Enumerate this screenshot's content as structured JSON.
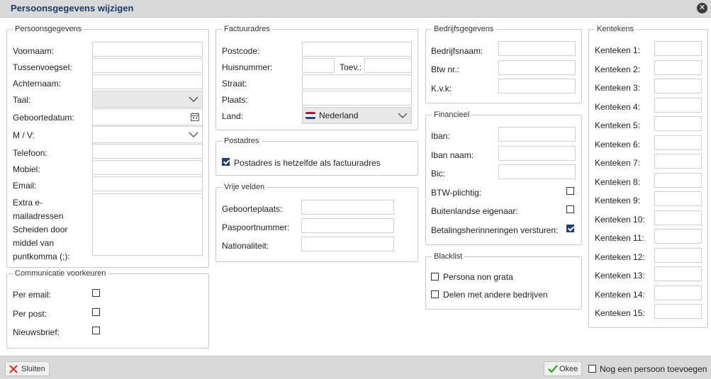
{
  "window": {
    "title": "Persoonsgegevens wijzigen"
  },
  "persoonsgegevens": {
    "legend": "Persoonsgegevens",
    "voornaam": "Voornaam:",
    "tussenvoegsel": "Tussenvoegsel:",
    "achternaam": "Achternaam:",
    "taal": "Taal:",
    "geboortedatum": "Geboortedatum:",
    "mv": "M / V:",
    "telefoon": "Telefoon:",
    "mobiel": "Mobiel:",
    "email": "Email:",
    "extra_lines": [
      "Extra e-",
      "mailadressen",
      "Scheiden door",
      "middel van",
      "puntkomma (;):"
    ]
  },
  "communicatie": {
    "legend": "Communicatie voorkeuren",
    "per_email": "Per email:",
    "per_post": "Per post:",
    "nieuwsbrief": "Nieuwsbrief:"
  },
  "factuuradres": {
    "legend": "Factuuradres",
    "postcode": "Postcode:",
    "huisnummer": "Huisnummer:",
    "toev": "Toev.:",
    "straat": "Straat:",
    "plaats": "Plaats:",
    "land": "Land:",
    "land_value": "Nederland"
  },
  "postadres": {
    "legend": "Postadres",
    "same_label": "Postadres is hetzelfde als factuuradres",
    "same_checked": true
  },
  "vrije_velden": {
    "legend": "Vrije velden",
    "geboorteplaats": "Geboorteplaats:",
    "paspoortnummer": "Paspoortnummer:",
    "nationaliteit": "Nationaliteit:"
  },
  "bedrijfsgegevens": {
    "legend": "Bedrijfsgegevens",
    "bedrijfsnaam": "Bedrijfsnaam:",
    "btw_nr": "Btw nr.:",
    "kvk": "K.v.k:"
  },
  "financieel": {
    "legend": "Financieel",
    "iban": "Iban:",
    "iban_naam": "Iban naam:",
    "bic": "Bic:",
    "btw_plichtig": "BTW-plichtig:",
    "buitenlandse": "Buitenlandse eigenaar:",
    "herinneringen": "Betalingsherinneringen versturen:",
    "herinneringen_checked": true
  },
  "blacklist": {
    "legend": "Blacklist",
    "non_grata": "Persona non grata",
    "delen": "Delen met andere bedrijven"
  },
  "kentekens": {
    "legend": "Kentekens",
    "items": [
      "Kenteken 1:",
      "Kenteken 2:",
      "Kenteken 3:",
      "Kenteken 4:",
      "Kenteken 5:",
      "Kenteken 6:",
      "Kenteken 7:",
      "Kenteken 8:",
      "Kenteken 9:",
      "Kenteken 10:",
      "Kenteken 11:",
      "Kenteken 12:",
      "Kenteken 13:",
      "Kenteken 14:",
      "Kenteken 15:"
    ]
  },
  "footer": {
    "sluiten": "Sluiten",
    "okee": "Okee",
    "nog_een": "Nog een persoon toevoegen"
  },
  "colors": {
    "accent": "#1f3f73",
    "title": "#1e3a6e",
    "flag": [
      "#ae1c28",
      "#ffffff",
      "#21468b"
    ]
  }
}
